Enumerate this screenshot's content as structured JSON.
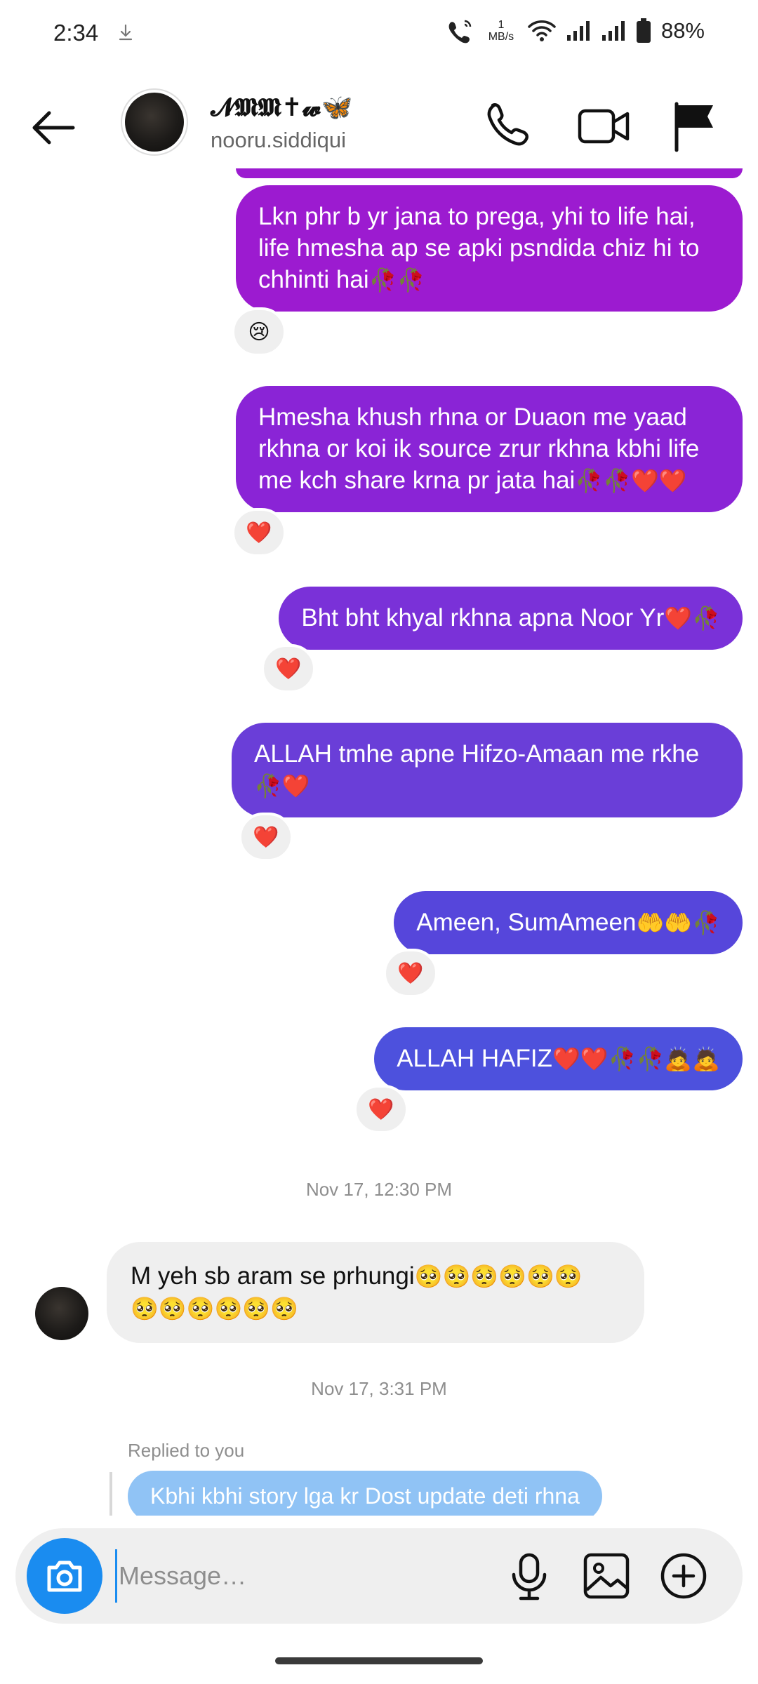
{
  "status_bar": {
    "time": "2:34",
    "net_speed_value": "1",
    "net_speed_unit": "MB/s",
    "battery": "88%"
  },
  "header": {
    "name": "𝓝𝕸𝕸✝𝔀🦋",
    "username": "nooru.siddiqui",
    "icons": [
      "back-arrow-icon",
      "phone-icon",
      "video-camera-icon",
      "flag-icon"
    ]
  },
  "messages": {
    "m1": {
      "text": "Lkn phr b yr jana to prega, yhi to life hai, life hmesha ap se apki psndida chiz hi to chhinti hai",
      "emoji": "🥀🥀",
      "reaction": "😢",
      "color": "#9c1bd0"
    },
    "m2": {
      "text": "Hmesha khush rhna or Duaon me yaad rkhna or koi ik source zrur rkhna kbhi life me kch share krna pr jata hai",
      "emoji": "🥀🥀❤️❤️",
      "reaction": "❤️",
      "color": "#8a24d6"
    },
    "m3": {
      "text": "Bht bht khyal rkhna apna Noor Yr",
      "emoji": "❤️🥀",
      "reaction": "❤️",
      "color": "#7a31d8"
    },
    "m4": {
      "text": "ALLAH tmhe apne Hifzo-Amaan me rkhe",
      "emoji": "🥀❤️",
      "reaction": "❤️",
      "color": "#6a3ed8"
    },
    "m5": {
      "text": "Ameen, SumAmeen",
      "emoji": "🤲🤲🥀",
      "reaction": "❤️",
      "color": "#5646db"
    },
    "m6": {
      "text": "ALLAH HAFIZ",
      "emoji": "❤️❤️🥀🥀🙇🙇",
      "reaction": "❤️",
      "color": "#4d51dd"
    }
  },
  "timestamps": {
    "t1": "Nov 17, 12:30 PM",
    "t2": "Nov 17, 3:31 PM"
  },
  "incoming": {
    "text": "M yeh sb aram se prhungi",
    "emoji_line1": "🥺🥺🥺🥺🥺🥺",
    "emoji_line2": "🥺🥺🥺🥺🥺🥺"
  },
  "reply": {
    "label": "Replied to you",
    "text": "Kbhi kbhi story lga kr Dost update deti rhna",
    "color": "#90c3f5"
  },
  "composer": {
    "placeholder": "Message…",
    "icons": [
      "camera-icon",
      "microphone-icon",
      "gallery-icon",
      "plus-circle-icon"
    ]
  },
  "colors": {
    "accent": "#1a8cf0",
    "incoming_bubble": "#efefef"
  }
}
